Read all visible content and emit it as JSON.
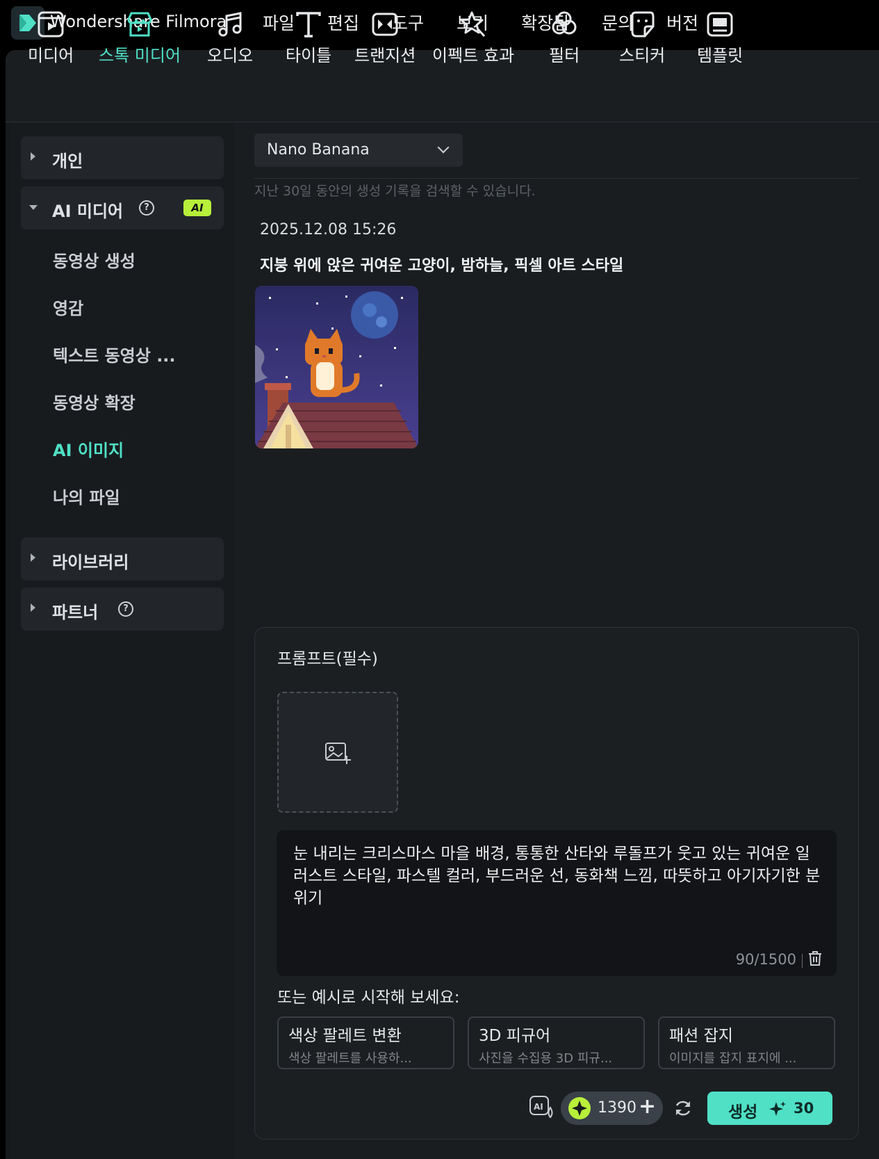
{
  "app": {
    "title": "Wondershare Filmora"
  },
  "menu": [
    "파일",
    "편집",
    "도구",
    "보기",
    "확장됨",
    "문의",
    "버전"
  ],
  "toolbar": {
    "tools": [
      {
        "label": "미디어",
        "icon": "media-icon"
      },
      {
        "label": "스톡 미디어",
        "icon": "stock-media-icon",
        "active": true
      },
      {
        "label": "오디오",
        "icon": "music-note-icon"
      },
      {
        "label": "타이틀",
        "icon": "title-t-icon"
      },
      {
        "label": "트랜지션",
        "icon": "transition-icon"
      },
      {
        "label": "이펙트 효과",
        "icon": "effects-star-icon"
      },
      {
        "label": "필터",
        "icon": "filter-icon"
      },
      {
        "label": "스티커",
        "icon": "sticker-icon"
      },
      {
        "label": "템플릿",
        "icon": "template-icon"
      }
    ]
  },
  "sidebar": {
    "personal": "개인",
    "ai_media": "AI 미디어",
    "ai_badge": "AI",
    "items": [
      "동영상 생성",
      "영감",
      "텍스트 동영상 ...",
      "동영상 확장",
      "AI 이미지",
      "나의 파일"
    ],
    "library": "라이브러리",
    "partner": "파트너"
  },
  "content": {
    "model": "Nano Banana",
    "hint": "지난 30일 동안의 생성 기록을 검색할 수 있습니다.",
    "record": {
      "time": "2025.12.08 15:26",
      "prompt": "지붕 위에 앉은 귀여운 고양이, 밤하늘, 픽셀 아트 스타일"
    }
  },
  "prompt_panel": {
    "title": "프롬프트(필수)",
    "text": "눈 내리는 크리스마스 마을 배경, 통통한 산타와 루돌프가 웃고 있는 귀여운 일러스트 스타일, 파스텔 컬러, 부드러운 선, 동화책 느낌, 따뜻하고 아기자기한 분위기",
    "char_count": "90/1500",
    "examples_label": "또는 예시로 시작해 보세요:",
    "examples": [
      {
        "title": "색상 팔레트 변환",
        "desc": "색상 팔레트를 사용하..."
      },
      {
        "title": "3D 피규어",
        "desc": "사진을 수집용 3D 피규..."
      },
      {
        "title": "패션 잡지",
        "desc": "이미지를 잡지 표지에 ..."
      }
    ],
    "credits": "1390",
    "generate_label": "생성",
    "generate_cost": "30"
  },
  "colors": {
    "accent": "#4fe0c6",
    "badge": "#b7ef3a",
    "bg": "#1a1d20"
  }
}
